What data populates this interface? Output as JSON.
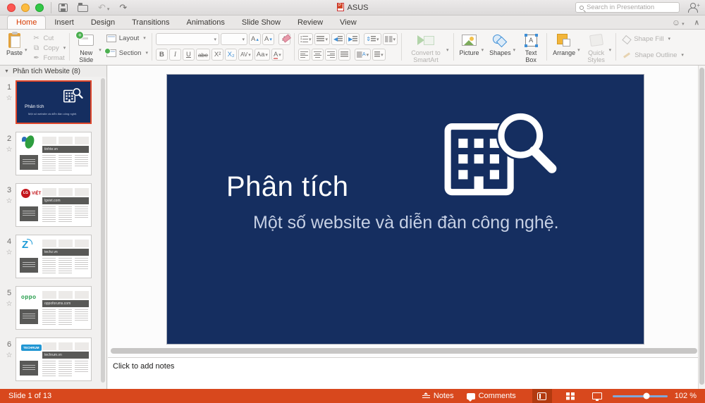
{
  "titlebar": {
    "title": "ASUS",
    "search_placeholder": "Search in Presentation"
  },
  "tabs": {
    "items": [
      {
        "label": "Home",
        "active": true
      },
      {
        "label": "Insert",
        "active": false
      },
      {
        "label": "Design",
        "active": false
      },
      {
        "label": "Transitions",
        "active": false
      },
      {
        "label": "Animations",
        "active": false
      },
      {
        "label": "Slide Show",
        "active": false
      },
      {
        "label": "Review",
        "active": false
      },
      {
        "label": "View",
        "active": false
      }
    ]
  },
  "ribbon": {
    "clipboard": {
      "paste_label": "Paste",
      "cut_label": "Cut",
      "copy_label": "Copy",
      "format_label": "Format"
    },
    "slides_group": {
      "new_slide_label": "New Slide",
      "layout_label": "Layout",
      "section_label": "Section"
    },
    "font_group": {
      "bold": "B",
      "italic": "I",
      "underline": "U",
      "strikethrough": "abe",
      "superscript": "X²",
      "subscript": "X₂",
      "char_spacing": "AV",
      "change_case": "Aa",
      "font_color": "A",
      "grow_font": "A",
      "shrink_font": "A",
      "clear_format": "A"
    },
    "smartart_group": {
      "convert_label": "Convert to SmartArt"
    },
    "insert_group": {
      "picture_label": "Picture",
      "shapes_label": "Shapes",
      "textbox_label": "Text Box"
    },
    "arrange_group": {
      "arrange_label": "Arrange",
      "quick_styles_label": "Quick Styles"
    },
    "shape_group": {
      "fill_label": "Shape Fill",
      "outline_label": "Shape Outline"
    }
  },
  "sidebar": {
    "header": "Phân tích Website (8)",
    "slides": [
      {
        "num": "1"
      },
      {
        "num": "2",
        "site": "tinhte.vn"
      },
      {
        "num": "3",
        "site": "lgviet.com",
        "logo": "LG",
        "logo_text": "VIỆT"
      },
      {
        "num": "4",
        "site": "techz.vn",
        "logo": "Z"
      },
      {
        "num": "5",
        "site": "oppoforums.com",
        "logo": "oppo"
      },
      {
        "num": "6",
        "site": "techrum.vn",
        "logo": "TECHRUM"
      }
    ]
  },
  "slide": {
    "title": "Phân tích",
    "subtitle": "Một số website và diễn đàn công nghệ.",
    "bg_color": "#152E60"
  },
  "notes": {
    "placeholder": "Click to add notes"
  },
  "statusbar": {
    "slide_info": "Slide 1 of 13",
    "notes_label": "Notes",
    "comments_label": "Comments",
    "zoom_percent": "102 %"
  },
  "colors": {
    "status_orange": "#D8481D",
    "home_tab_red": "#D83B01",
    "selection_border": "#E0472B",
    "slide_navy": "#152E60"
  }
}
